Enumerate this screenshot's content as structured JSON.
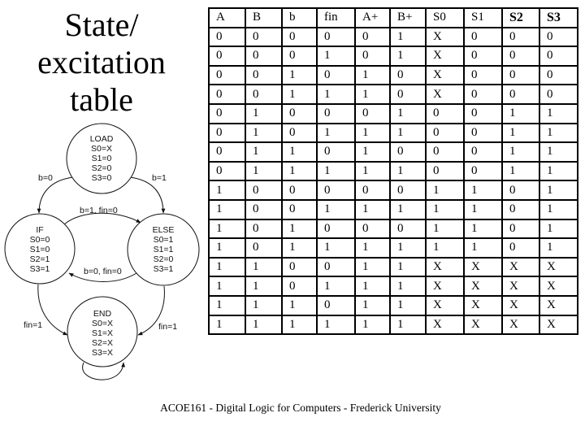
{
  "title": {
    "lines": [
      "State/",
      "excitation",
      "table"
    ]
  },
  "diagram": {
    "states": [
      {
        "name": "LOAD",
        "outputs": [
          "S0=X",
          "S1=0",
          "S2=0",
          "S3=0"
        ]
      },
      {
        "name": "IF",
        "outputs": [
          "S0=0",
          "S1=0",
          "S2=1",
          "S3=1"
        ]
      },
      {
        "name": "ELSE",
        "outputs": [
          "S0=1",
          "S1=1",
          "S2=0",
          "S3=1"
        ]
      },
      {
        "name": "END",
        "outputs": [
          "S0=X",
          "S1=X",
          "S2=X",
          "S3=X"
        ]
      }
    ],
    "transitions": [
      {
        "from": "LOAD",
        "to": "IF",
        "label": "b=0"
      },
      {
        "from": "LOAD",
        "to": "ELSE",
        "label": "b=1"
      },
      {
        "from": "IF",
        "to": "ELSE",
        "label": "b=1,  fin=0"
      },
      {
        "from": "ELSE",
        "to": "IF",
        "label": "b=0,  fin=0"
      },
      {
        "from": "IF",
        "to": "END",
        "label": "fin=1"
      },
      {
        "from": "ELSE",
        "to": "END",
        "label": "fin=1"
      },
      {
        "from": "END",
        "to": "END",
        "label": ""
      }
    ]
  },
  "table": {
    "headers": [
      "A",
      "B",
      "b",
      "fin",
      "A+",
      "B+",
      "S0",
      "S1",
      "S2",
      "S3"
    ],
    "rows": [
      [
        "0",
        "0",
        "0",
        "0",
        "0",
        "1",
        "X",
        "0",
        "0",
        "0"
      ],
      [
        "0",
        "0",
        "0",
        "1",
        "0",
        "1",
        "X",
        "0",
        "0",
        "0"
      ],
      [
        "0",
        "0",
        "1",
        "0",
        "1",
        "0",
        "X",
        "0",
        "0",
        "0"
      ],
      [
        "0",
        "0",
        "1",
        "1",
        "1",
        "0",
        "X",
        "0",
        "0",
        "0"
      ],
      [
        "0",
        "1",
        "0",
        "0",
        "0",
        "1",
        "0",
        "0",
        "1",
        "1"
      ],
      [
        "0",
        "1",
        "0",
        "1",
        "1",
        "1",
        "0",
        "0",
        "1",
        "1"
      ],
      [
        "0",
        "1",
        "1",
        "0",
        "1",
        "0",
        "0",
        "0",
        "1",
        "1"
      ],
      [
        "0",
        "1",
        "1",
        "1",
        "1",
        "1",
        "0",
        "0",
        "1",
        "1"
      ],
      [
        "1",
        "0",
        "0",
        "0",
        "0",
        "0",
        "1",
        "1",
        "0",
        "1"
      ],
      [
        "1",
        "0",
        "0",
        "1",
        "1",
        "1",
        "1",
        "1",
        "0",
        "1"
      ],
      [
        "1",
        "0",
        "1",
        "0",
        "0",
        "0",
        "1",
        "1",
        "0",
        "1"
      ],
      [
        "1",
        "0",
        "1",
        "1",
        "1",
        "1",
        "1",
        "1",
        "0",
        "1"
      ],
      [
        "1",
        "1",
        "0",
        "0",
        "1",
        "1",
        "X",
        "X",
        "X",
        "X"
      ],
      [
        "1",
        "1",
        "0",
        "1",
        "1",
        "1",
        "X",
        "X",
        "X",
        "X"
      ],
      [
        "1",
        "1",
        "1",
        "0",
        "1",
        "1",
        "X",
        "X",
        "X",
        "X"
      ],
      [
        "1",
        "1",
        "1",
        "1",
        "1",
        "1",
        "X",
        "X",
        "X",
        "X"
      ]
    ]
  },
  "footer": {
    "text": "ACOE161 - Digital Logic for Computers - Frederick University"
  }
}
